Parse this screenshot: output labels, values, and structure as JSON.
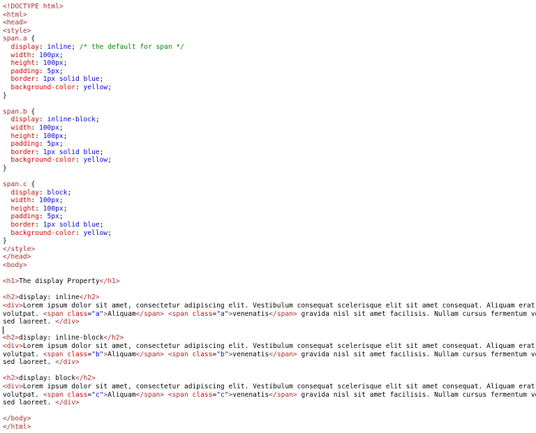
{
  "editor": {
    "lines": [
      [
        {
          "t": "<!DOCTYPE html>",
          "k": "tag"
        }
      ],
      [
        {
          "t": "<html>",
          "k": "tag"
        }
      ],
      [
        {
          "t": "<head>",
          "k": "tag"
        }
      ],
      [
        {
          "t": "<style>",
          "k": "tag"
        }
      ],
      [
        {
          "t": "span.a",
          "k": "sel"
        },
        {
          "t": " {",
          "k": "punct"
        }
      ],
      [
        {
          "t": "  display",
          "k": "prop"
        },
        {
          "t": ": ",
          "k": "punct"
        },
        {
          "t": "inline",
          "k": "val"
        },
        {
          "t": "; ",
          "k": "punct"
        },
        {
          "t": "/* the default for span */",
          "k": "com"
        }
      ],
      [
        {
          "t": "  width",
          "k": "prop"
        },
        {
          "t": ": ",
          "k": "punct"
        },
        {
          "t": "100px",
          "k": "val"
        },
        {
          "t": ";",
          "k": "punct"
        }
      ],
      [
        {
          "t": "  height",
          "k": "prop"
        },
        {
          "t": ": ",
          "k": "punct"
        },
        {
          "t": "100px",
          "k": "val"
        },
        {
          "t": ";",
          "k": "punct"
        }
      ],
      [
        {
          "t": "  padding",
          "k": "prop"
        },
        {
          "t": ": ",
          "k": "punct"
        },
        {
          "t": "5px",
          "k": "val"
        },
        {
          "t": ";",
          "k": "punct"
        }
      ],
      [
        {
          "t": "  border",
          "k": "prop"
        },
        {
          "t": ": ",
          "k": "punct"
        },
        {
          "t": "1px solid blue",
          "k": "val"
        },
        {
          "t": ";",
          "k": "punct"
        }
      ],
      [
        {
          "t": "  background-color",
          "k": "prop"
        },
        {
          "t": ": ",
          "k": "punct"
        },
        {
          "t": "yellow",
          "k": "val"
        },
        {
          "t": ";",
          "k": "punct"
        }
      ],
      [
        {
          "t": "}",
          "k": "punct"
        }
      ],
      [],
      [
        {
          "t": "span.b",
          "k": "sel"
        },
        {
          "t": " {",
          "k": "punct"
        }
      ],
      [
        {
          "t": "  display",
          "k": "prop"
        },
        {
          "t": ": ",
          "k": "punct"
        },
        {
          "t": "inline-block",
          "k": "val"
        },
        {
          "t": ";",
          "k": "punct"
        }
      ],
      [
        {
          "t": "  width",
          "k": "prop"
        },
        {
          "t": ": ",
          "k": "punct"
        },
        {
          "t": "100px",
          "k": "val"
        },
        {
          "t": ";",
          "k": "punct"
        }
      ],
      [
        {
          "t": "  height",
          "k": "prop"
        },
        {
          "t": ": ",
          "k": "punct"
        },
        {
          "t": "100px",
          "k": "val"
        },
        {
          "t": ";",
          "k": "punct"
        }
      ],
      [
        {
          "t": "  padding",
          "k": "prop"
        },
        {
          "t": ": ",
          "k": "punct"
        },
        {
          "t": "5px",
          "k": "val"
        },
        {
          "t": ";",
          "k": "punct"
        }
      ],
      [
        {
          "t": "  border",
          "k": "prop"
        },
        {
          "t": ": ",
          "k": "punct"
        },
        {
          "t": "1px solid blue",
          "k": "val"
        },
        {
          "t": ";",
          "k": "punct"
        }
      ],
      [
        {
          "t": "  background-color",
          "k": "prop"
        },
        {
          "t": ": ",
          "k": "punct"
        },
        {
          "t": "yellow",
          "k": "val"
        },
        {
          "t": ";",
          "k": "punct"
        }
      ],
      [
        {
          "t": "}",
          "k": "punct"
        }
      ],
      [],
      [
        {
          "t": "span.c",
          "k": "sel"
        },
        {
          "t": " {",
          "k": "punct"
        }
      ],
      [
        {
          "t": "  display",
          "k": "prop"
        },
        {
          "t": ": ",
          "k": "punct"
        },
        {
          "t": "block",
          "k": "val"
        },
        {
          "t": ";",
          "k": "punct"
        }
      ],
      [
        {
          "t": "  width",
          "k": "prop"
        },
        {
          "t": ": ",
          "k": "punct"
        },
        {
          "t": "100px",
          "k": "val"
        },
        {
          "t": ";",
          "k": "punct"
        }
      ],
      [
        {
          "t": "  height",
          "k": "prop"
        },
        {
          "t": ": ",
          "k": "punct"
        },
        {
          "t": "100px",
          "k": "val"
        },
        {
          "t": ";",
          "k": "punct"
        }
      ],
      [
        {
          "t": "  padding",
          "k": "prop"
        },
        {
          "t": ": ",
          "k": "punct"
        },
        {
          "t": "5px",
          "k": "val"
        },
        {
          "t": ";",
          "k": "punct"
        }
      ],
      [
        {
          "t": "  border",
          "k": "prop"
        },
        {
          "t": ": ",
          "k": "punct"
        },
        {
          "t": "1px solid blue",
          "k": "val"
        },
        {
          "t": ";",
          "k": "punct"
        }
      ],
      [
        {
          "t": "  background-color",
          "k": "prop"
        },
        {
          "t": ": ",
          "k": "punct"
        },
        {
          "t": "yellow",
          "k": "val"
        },
        {
          "t": ";",
          "k": "punct"
        }
      ],
      [
        {
          "t": "}",
          "k": "punct"
        }
      ],
      [
        {
          "t": "</style>",
          "k": "tag"
        }
      ],
      [
        {
          "t": "</head>",
          "k": "tag"
        }
      ],
      [
        {
          "t": "<body>",
          "k": "tag"
        }
      ],
      [],
      [
        {
          "t": "<h1>",
          "k": "tag"
        },
        {
          "t": "The display Property",
          "k": "txt"
        },
        {
          "t": "</h1>",
          "k": "tag"
        }
      ],
      [],
      [
        {
          "t": "<h2>",
          "k": "tag"
        },
        {
          "t": "display: inline",
          "k": "txt"
        },
        {
          "t": "</h2>",
          "k": "tag"
        }
      ],
      [
        {
          "t": "<div>",
          "k": "tag"
        },
        {
          "t": "Lorem ipsum dolor sit amet, consectetur adipiscing elit. Vestibulum consequat scelerisque elit sit amet consequat. Aliquam erat",
          "k": "txt"
        }
      ],
      [
        {
          "t": "volutpat. ",
          "k": "txt"
        },
        {
          "t": "<span ",
          "k": "tag"
        },
        {
          "t": "class",
          "k": "attr"
        },
        {
          "t": "=",
          "k": "punct"
        },
        {
          "t": "\"a\"",
          "k": "str"
        },
        {
          "t": ">",
          "k": "tag"
        },
        {
          "t": "Aliquam",
          "k": "txt"
        },
        {
          "t": "</span>",
          "k": "tag"
        },
        {
          "t": " ",
          "k": "txt"
        },
        {
          "t": "<span ",
          "k": "tag"
        },
        {
          "t": "class",
          "k": "attr"
        },
        {
          "t": "=",
          "k": "punct"
        },
        {
          "t": "\"a\"",
          "k": "str"
        },
        {
          "t": ">",
          "k": "tag"
        },
        {
          "t": "venenatis",
          "k": "txt"
        },
        {
          "t": "</span>",
          "k": "tag"
        },
        {
          "t": " gravida nisl sit amet facilisis. Nullam cursus fermentum velit",
          "k": "txt"
        }
      ],
      [
        {
          "t": "sed laoreet. ",
          "k": "txt"
        },
        {
          "t": "</div>",
          "k": "tag"
        }
      ],
      [],
      [
        {
          "t": "<h2>",
          "k": "tag"
        },
        {
          "t": "display: inline-block",
          "k": "txt"
        },
        {
          "t": "</h2>",
          "k": "tag"
        }
      ],
      [
        {
          "t": "<div>",
          "k": "tag"
        },
        {
          "t": "Lorem ipsum dolor sit amet, consectetur adipiscing elit. Vestibulum consequat scelerisque elit sit amet consequat. Aliquam erat",
          "k": "txt"
        }
      ],
      [
        {
          "t": "volutpat. ",
          "k": "txt"
        },
        {
          "t": "<span ",
          "k": "tag"
        },
        {
          "t": "class",
          "k": "attr"
        },
        {
          "t": "=",
          "k": "punct"
        },
        {
          "t": "\"b\"",
          "k": "str"
        },
        {
          "t": ">",
          "k": "tag"
        },
        {
          "t": "Aliquam",
          "k": "txt"
        },
        {
          "t": "</span>",
          "k": "tag"
        },
        {
          "t": " ",
          "k": "txt"
        },
        {
          "t": "<span ",
          "k": "tag"
        },
        {
          "t": "class",
          "k": "attr"
        },
        {
          "t": "=",
          "k": "punct"
        },
        {
          "t": "\"b\"",
          "k": "str"
        },
        {
          "t": ">",
          "k": "tag"
        },
        {
          "t": "venenatis",
          "k": "txt"
        },
        {
          "t": "</span>",
          "k": "tag"
        },
        {
          "t": " gravida nisl sit amet facilisis. Nullam cursus fermentum velit",
          "k": "txt"
        }
      ],
      [
        {
          "t": "sed laoreet. ",
          "k": "txt"
        },
        {
          "t": "</div>",
          "k": "tag"
        }
      ],
      [],
      [
        {
          "t": "<h2>",
          "k": "tag"
        },
        {
          "t": "display: block",
          "k": "txt"
        },
        {
          "t": "</h2>",
          "k": "tag"
        }
      ],
      [
        {
          "t": "<div>",
          "k": "tag"
        },
        {
          "t": "Lorem ipsum dolor sit amet, consectetur adipiscing elit. Vestibulum consequat scelerisque elit sit amet consequat. Aliquam erat",
          "k": "txt"
        }
      ],
      [
        {
          "t": "volutpat. ",
          "k": "txt"
        },
        {
          "t": "<span ",
          "k": "tag"
        },
        {
          "t": "class",
          "k": "attr"
        },
        {
          "t": "=",
          "k": "punct"
        },
        {
          "t": "\"c\"",
          "k": "str"
        },
        {
          "t": ">",
          "k": "tag"
        },
        {
          "t": "Aliquam",
          "k": "txt"
        },
        {
          "t": "</span>",
          "k": "tag"
        },
        {
          "t": " ",
          "k": "txt"
        },
        {
          "t": "<span ",
          "k": "tag"
        },
        {
          "t": "class",
          "k": "attr"
        },
        {
          "t": "=",
          "k": "punct"
        },
        {
          "t": "\"c\"",
          "k": "str"
        },
        {
          "t": ">",
          "k": "tag"
        },
        {
          "t": "venenatis",
          "k": "txt"
        },
        {
          "t": "</span>",
          "k": "tag"
        },
        {
          "t": " gravida nisl sit amet facilisis. Nullam cursus fermentum velit",
          "k": "txt"
        }
      ],
      [
        {
          "t": "sed laoreet. ",
          "k": "txt"
        },
        {
          "t": "</div>",
          "k": "tag"
        }
      ],
      [],
      [
        {
          "t": "</body>",
          "k": "tag"
        }
      ],
      [
        {
          "t": "</html>",
          "k": "tag"
        }
      ]
    ]
  },
  "colors": {
    "tag": "#a52a2a",
    "property": "#cc0000",
    "value": "#0000cd",
    "comment": "#008000",
    "text": "#000000",
    "background": "#ffffff"
  }
}
